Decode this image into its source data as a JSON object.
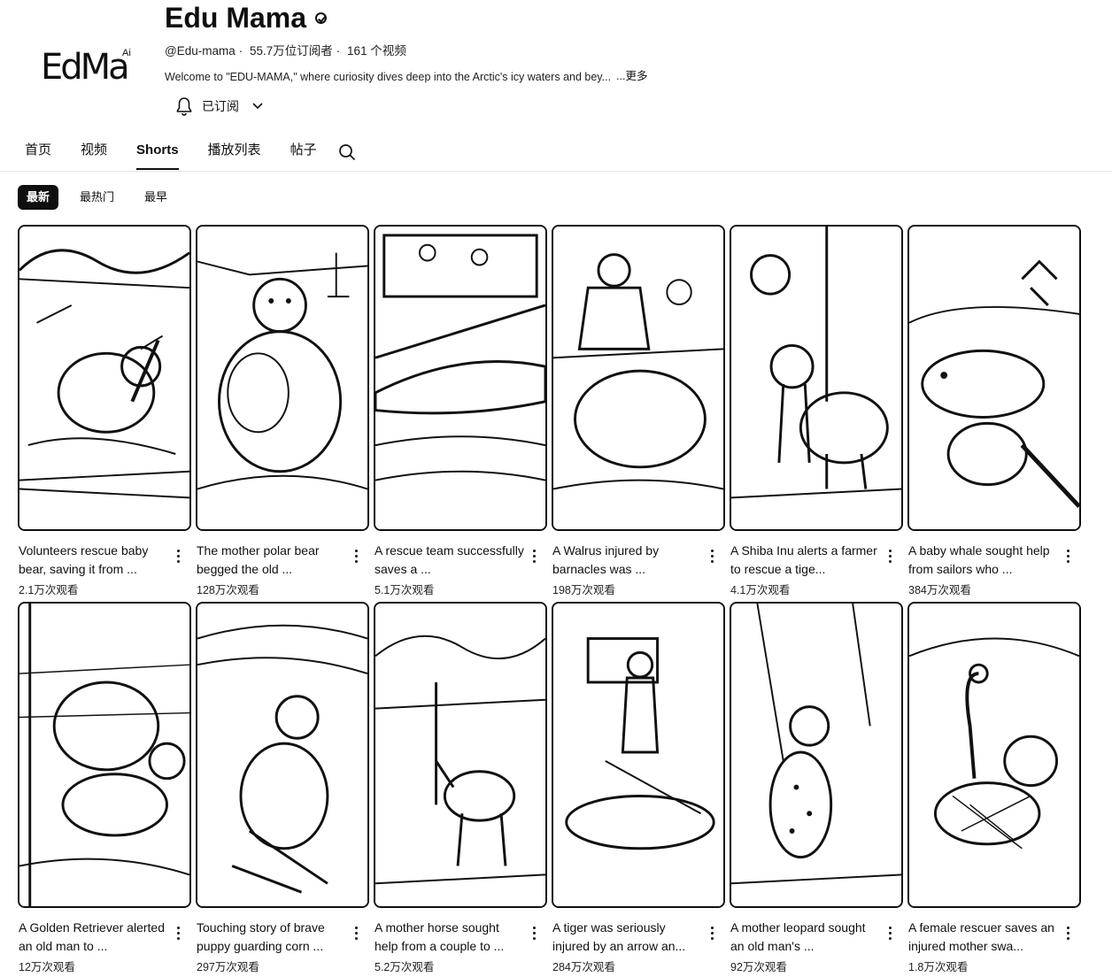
{
  "channel": {
    "logo_text": "EdMa",
    "logo_superscript": "Ai",
    "name": "Edu Mama",
    "handle": "@Edu-mama",
    "subscribers": "55.7万位订阅者",
    "video_count": "161 个视频",
    "description": "Welcome to \"EDU-MAMA,\" where curiosity dives deep into the Arctic's icy waters and bey...",
    "more_label": "...更多",
    "subscribe_label": "已订阅"
  },
  "tabs": [
    {
      "label": "首页",
      "active": false
    },
    {
      "label": "视频",
      "active": false
    },
    {
      "label": "Shorts",
      "active": true
    },
    {
      "label": "播放列表",
      "active": false
    },
    {
      "label": "帖子",
      "active": false
    }
  ],
  "chips": [
    {
      "label": "最新",
      "active": true
    },
    {
      "label": "最热门",
      "active": false
    },
    {
      "label": "最早",
      "active": false
    }
  ],
  "shorts": [
    {
      "title": "Volunteers rescue baby bear, saving it from ...",
      "views": "2.1万次观看",
      "icon": "bear"
    },
    {
      "title": "The mother polar bear begged the old ...",
      "views": "128万次观看",
      "icon": "polar-bear"
    },
    {
      "title": "A rescue team successfully saves a ...",
      "views": "5.1万次观看",
      "icon": "whale-boat"
    },
    {
      "title": "A Walrus injured by barnacles was ...",
      "views": "198万次观看",
      "icon": "walrus"
    },
    {
      "title": "A Shiba Inu alerts a farmer to rescue a tige...",
      "views": "4.1万次观看",
      "icon": "tiger"
    },
    {
      "title": "A baby whale sought help from sailors who ...",
      "views": "384万次观看",
      "icon": "whale"
    },
    {
      "title": "A Golden Retriever alerted an old man to ...",
      "views": "12万次观看",
      "icon": "dog"
    },
    {
      "title": "Touching story of brave puppy guarding corn ...",
      "views": "297万次观看",
      "icon": "puppy"
    },
    {
      "title": "A mother horse sought help from a couple to ...",
      "views": "5.2万次观看",
      "icon": "horse"
    },
    {
      "title": "A tiger was seriously injured by an arrow an...",
      "views": "284万次观看",
      "icon": "tiger-injured"
    },
    {
      "title": "A mother leopard sought an old man's ...",
      "views": "92万次观看",
      "icon": "leopard"
    },
    {
      "title": "A female rescuer saves an injured mother swa...",
      "views": "1.8万次观看",
      "icon": "swan"
    }
  ],
  "colors": {
    "text": "#0f0f0f",
    "chip_active_bg": "#0f0f0f",
    "chip_active_text": "#ffffff"
  }
}
